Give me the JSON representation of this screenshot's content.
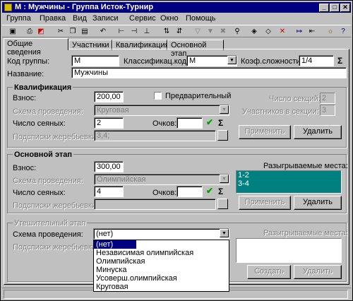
{
  "window": {
    "title": "М : Мужчины - Группа Исток-Турнир"
  },
  "menu": [
    "Группа",
    "Правка",
    "Вид",
    "Записи",
    "Сервис",
    "Окно",
    "Помощь"
  ],
  "tabs": [
    "Общие сведения",
    "Участники",
    "Квалификация",
    "Основной этап"
  ],
  "general": {
    "group_code_label": "Код группы:",
    "group_code": "М",
    "class_code_label": "Классификац.код:",
    "class_code": "М",
    "complexity_label": "Коэф.сложности:",
    "complexity": "1/4",
    "name_label": "Название:",
    "name": "Мужчины"
  },
  "qual": {
    "title": "Квалификация",
    "fee_label": "Взнос:",
    "fee": "200,00",
    "preliminary_label": "Предварительный",
    "scheme_label": "Схема проведения:",
    "scheme": "Круговая",
    "seeded_label": "Число сеяных:",
    "seeded": "2",
    "points_label": "Очков:",
    "draw_label": "Подсписки жеребьевки",
    "draw": "3,4;",
    "sections_label": "Число секций:",
    "sections": "2",
    "per_section_label": "Участников в секции:",
    "per_section": "3",
    "apply": "Применить",
    "delete": "Удалить"
  },
  "main": {
    "title": "Основной этап",
    "fee_label": "Взнос:",
    "fee": "300,00",
    "scheme_label": "Схема проведения:",
    "scheme": "Олимпийская",
    "seeded_label": "Число сеяных:",
    "seeded": "4",
    "points_label": "Очков:",
    "draw_label": "Подсписки жеребьевки",
    "places_label": "Разыгрываемые места:",
    "places": [
      "1-2",
      "3-4"
    ],
    "apply": "Применить",
    "delete": "Удалить"
  },
  "consol": {
    "title": "Утешительный этап",
    "scheme_label": "Схема проведения:",
    "scheme": "(нет)",
    "draw_label": "Подсписки жеребьевки",
    "places_label": "Разыгрываемые места:",
    "apply": "Создать",
    "delete": "Удалить"
  },
  "dropdown_options": [
    "(нет)",
    "Независимая олимпийская",
    "Олимпийская",
    "Минуска",
    "Усоверш.олимпийская",
    "Круговая"
  ],
  "colors": {
    "title_bg": "#000080",
    "list_teal": "#008080",
    "check": "#00a000"
  }
}
